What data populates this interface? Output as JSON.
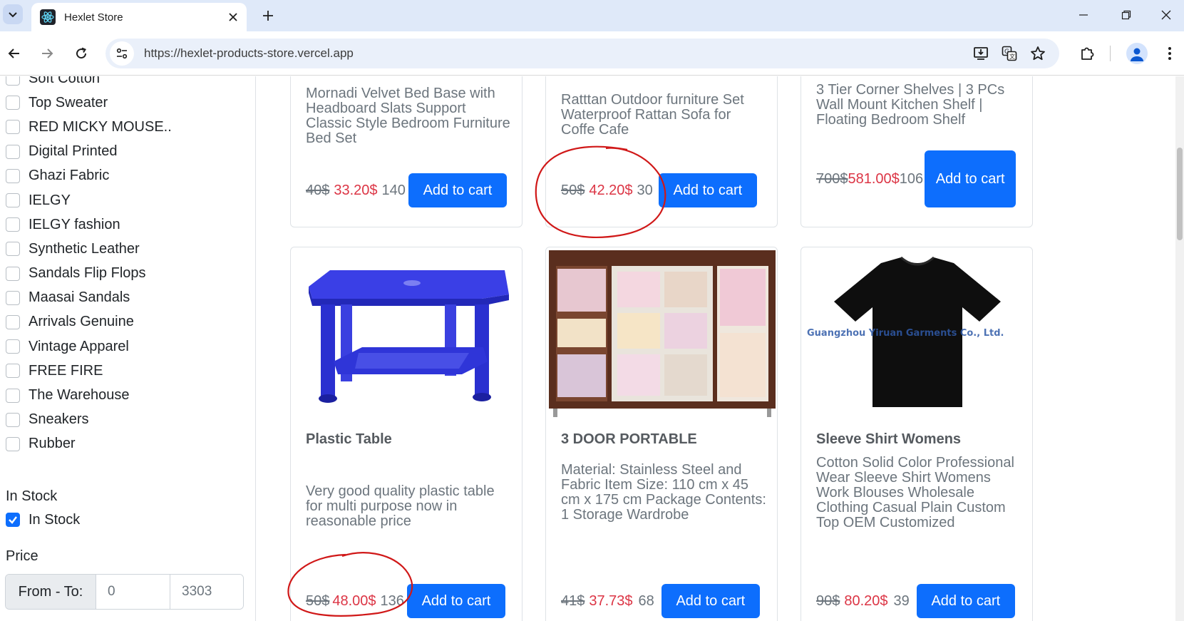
{
  "browser": {
    "tab_title": "Hexlet Store",
    "url": "https://hexlet-products-store.vercel.app"
  },
  "sidebar": {
    "brands": [
      {
        "label": "Soft Cotton",
        "checked": false
      },
      {
        "label": "Top Sweater",
        "checked": false
      },
      {
        "label": "RED MICKY MOUSE..",
        "checked": false
      },
      {
        "label": "Digital Printed",
        "checked": false
      },
      {
        "label": "Ghazi Fabric",
        "checked": false
      },
      {
        "label": "IELGY",
        "checked": false
      },
      {
        "label": "IELGY fashion",
        "checked": false
      },
      {
        "label": "Synthetic Leather",
        "checked": false
      },
      {
        "label": "Sandals Flip Flops",
        "checked": false
      },
      {
        "label": "Maasai Sandals",
        "checked": false
      },
      {
        "label": "Arrivals Genuine",
        "checked": false
      },
      {
        "label": "Vintage Apparel",
        "checked": false
      },
      {
        "label": "FREE FIRE",
        "checked": false
      },
      {
        "label": "The Warehouse",
        "checked": false
      },
      {
        "label": "Sneakers",
        "checked": false
      },
      {
        "label": "Rubber",
        "checked": false
      }
    ],
    "in_stock_title": "In Stock",
    "in_stock_label": "In Stock",
    "in_stock_checked": true,
    "price_title": "Price",
    "price_prefix": "From - To:",
    "price_from": "0",
    "price_to": "3303"
  },
  "products": [
    {
      "title": "",
      "desc": "Mornadi Velvet Bed Base with Headboard Slats Support Classic Style Bedroom Furniture Bed Set",
      "old": "40$",
      "new": "33.20$",
      "stock": "140",
      "button": "Add to cart"
    },
    {
      "title": "",
      "desc": "Ratttan Outdoor furniture Set Waterproof Rattan Sofa for Coffe Cafe",
      "old": "50$",
      "new": "42.20$",
      "stock": "30",
      "button": "Add to cart"
    },
    {
      "title": "",
      "desc": "3 Tier Corner Shelves | 3 PCs Wall Mount Kitchen Shelf | Floating Bedroom Shelf",
      "old": "700$",
      "new": "581.00$",
      "stock": "106",
      "button": "Add to cart"
    },
    {
      "title": "Plastic Table",
      "desc": "Very good quality plastic table for multi purpose now in reasonable price",
      "old": "50$",
      "new": "48.00$",
      "stock": "136",
      "button": "Add to cart"
    },
    {
      "title": "3 DOOR PORTABLE",
      "desc": "Material: Stainless Steel and Fabric Item Size: 110 cm x 45 cm x 175 cm Package Contents: 1 Storage Wardrobe",
      "old": "41$",
      "new": "37.73$",
      "stock": "68",
      "button": "Add to cart"
    },
    {
      "title": "Sleeve Shirt Womens",
      "desc": "Cotton Solid Color Professional Wear Sleeve Shirt Womens Work Blouses Wholesale Clothing Casual Plain Custom Top OEM Customized",
      "old": "90$",
      "new": "80.20$",
      "stock": "39",
      "button": "Add to cart"
    }
  ],
  "shirt_watermark": "Guangzhou Yiruan Garments Co., Ltd."
}
